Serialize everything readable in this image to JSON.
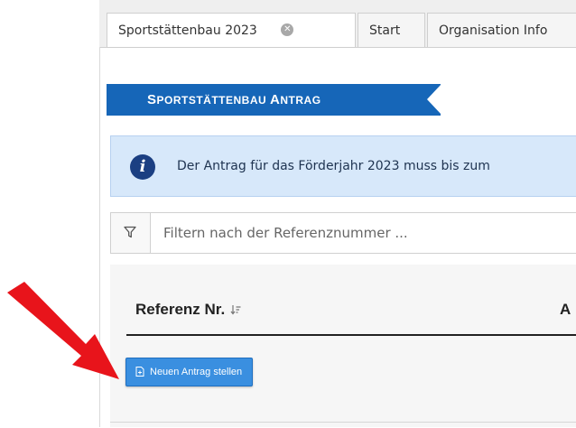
{
  "tabs": [
    {
      "label": "Sportstättenbau 2023",
      "active": true,
      "closable": true
    },
    {
      "label": "Start"
    },
    {
      "label": "Organisation Info"
    }
  ],
  "header": {
    "ribbon_big_S": "S",
    "ribbon_rest1": "PORTSTÄTTENBAU ",
    "ribbon_big_A": "A",
    "ribbon_rest2": "NTRAG"
  },
  "info": {
    "icon": "info-icon",
    "text": "Der Antrag für das Förderjahr 2023 muss bis zum"
  },
  "filter": {
    "icon": "filter-icon",
    "placeholder": "Filtern nach der Referenznummer ..."
  },
  "table": {
    "columns": [
      {
        "label": "Referenz Nr.",
        "sort_icon": "sort-desc-icon"
      },
      {
        "label": "A"
      }
    ]
  },
  "actions": {
    "new_application_label": "Neuen Antrag stellen",
    "new_application_icon": "new-document-icon"
  },
  "annotation": {
    "arrow_color": "#e8141b"
  },
  "colors": {
    "ribbon": "#1666b8",
    "info_bg": "#d7e8fa",
    "button": "#3a8fe0"
  }
}
